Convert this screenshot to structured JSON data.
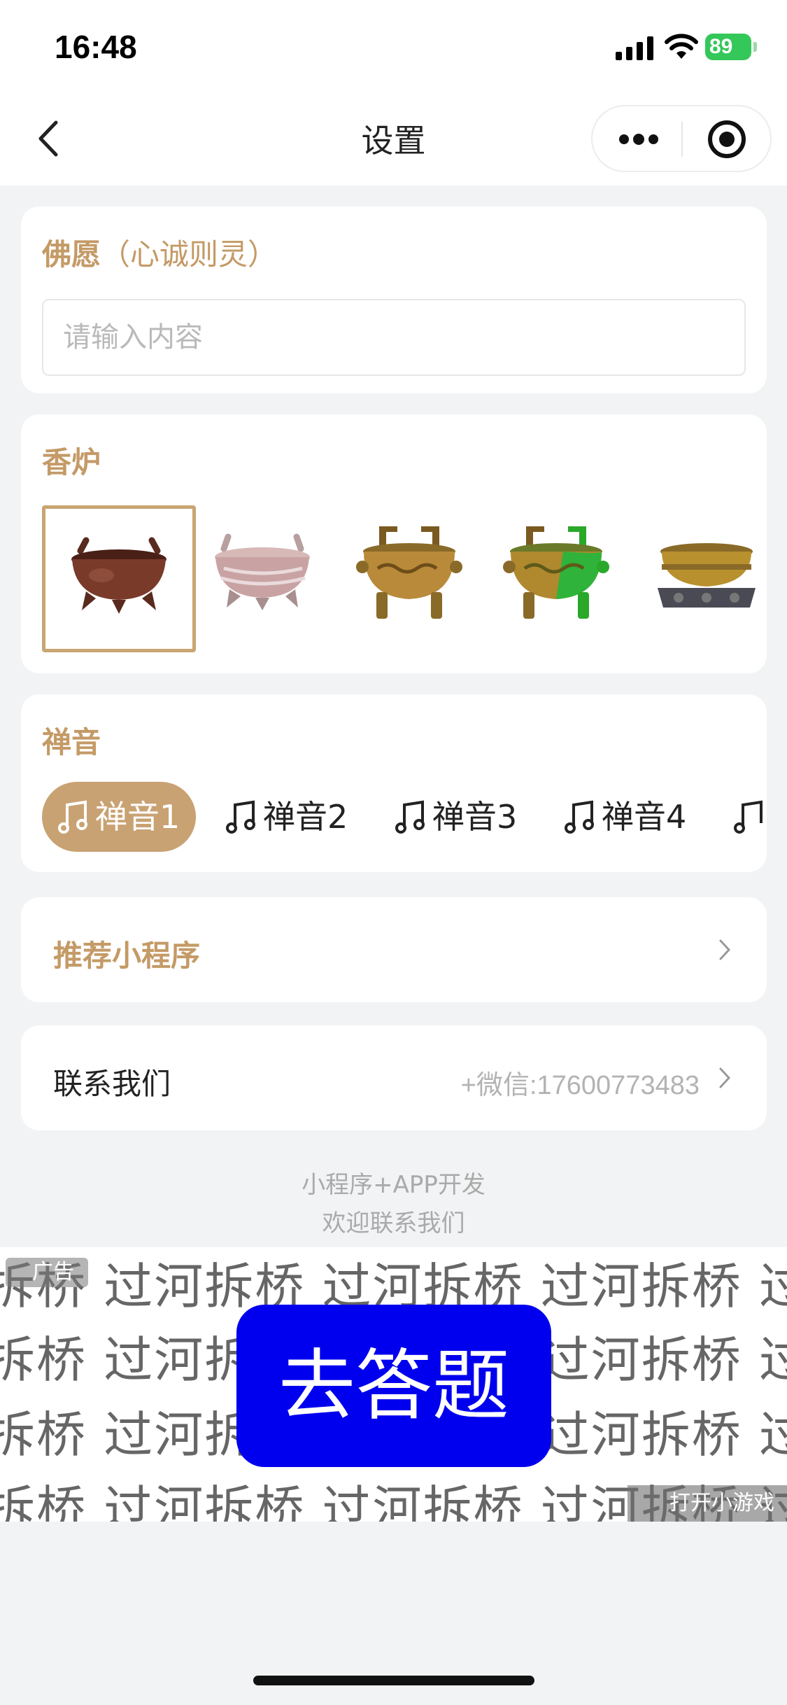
{
  "status_bar": {
    "time": "16:48",
    "battery": "89"
  },
  "nav": {
    "title": "设置"
  },
  "wish": {
    "title": "佛愿",
    "hint": "（心诚则灵）",
    "placeholder": "请输入内容",
    "value": ""
  },
  "burner": {
    "title": "香炉",
    "selected_index": 0,
    "items": [
      "burner-1",
      "burner-2",
      "burner-3",
      "burner-4",
      "burner-5"
    ]
  },
  "music": {
    "title": "禅音",
    "items": [
      {
        "label": "禅音1",
        "active": true
      },
      {
        "label": "禅音2",
        "active": false
      },
      {
        "label": "禅音3",
        "active": false
      },
      {
        "label": "禅音4",
        "active": false
      }
    ]
  },
  "recommend": {
    "label": "推荐小程序"
  },
  "contact": {
    "label": "联系我们",
    "value": "+微信:17600773483"
  },
  "footer": {
    "line1": "小程序+APP开发",
    "line2": "欢迎联系我们"
  },
  "ad": {
    "tag": "广告",
    "lines": [
      "拆桥 过河拆桥 过河拆桥 过河拆桥 过河",
      "拆桥 过河拆桥 过河拆桥 过河拆桥 过河",
      "拆桥 过河拆桥 过河拆桥 过河拆桥 过河",
      "拆桥 过河拆桥 过河拆桥 过河拆桥 过河"
    ],
    "cta": "去答题",
    "open_label": "打开小游戏"
  },
  "colors": {
    "accent": "#c49a66",
    "pill_active": "#c9a273",
    "cta_bg": "#0000ee",
    "battery": "#34c759"
  }
}
